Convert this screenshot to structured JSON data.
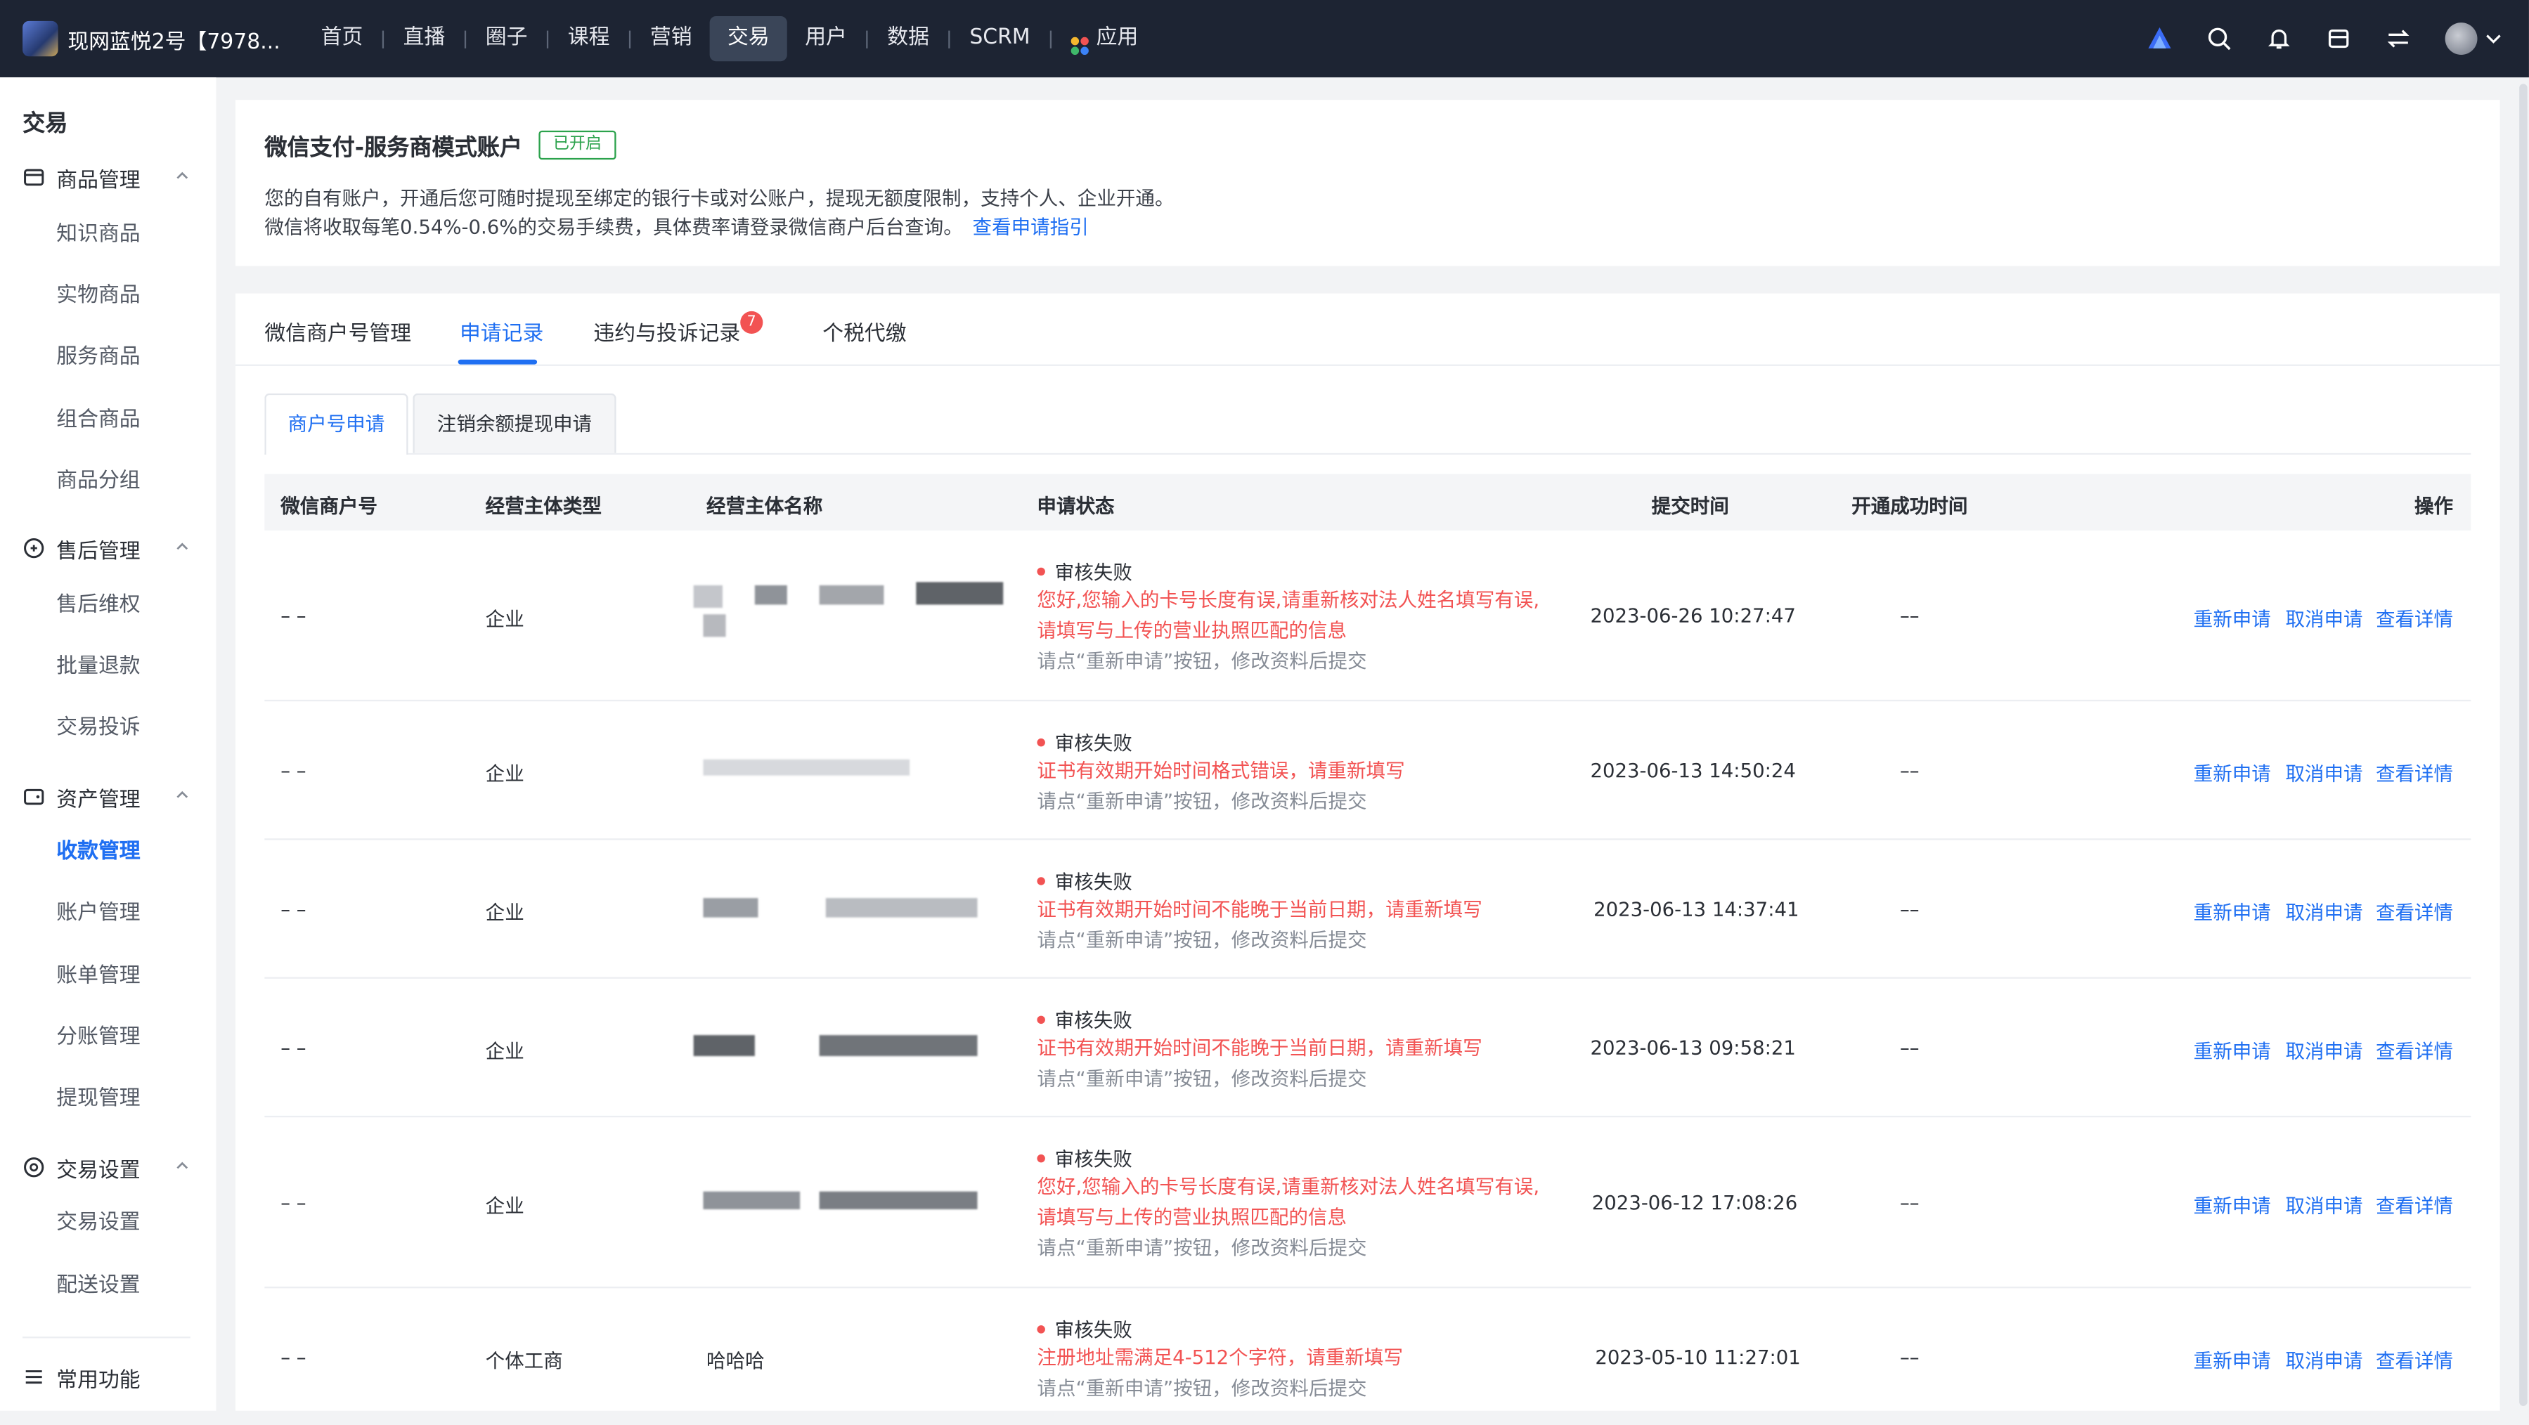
{
  "topbar": {
    "shop_name": "现网蓝悦2号【7978...",
    "nav": [
      "首页",
      "直播",
      "圈子",
      "课程",
      "营销",
      "交易",
      "用户",
      "数据",
      "SCRM",
      "应用"
    ],
    "active_nav": "交易",
    "icons": [
      "brand-logo-icon",
      "search-icon",
      "bell-icon",
      "store-icon",
      "switch-icon",
      "avatar",
      "chevron-down-icon"
    ]
  },
  "sidebar": {
    "title": "交易",
    "groups": [
      {
        "label": "商品管理",
        "icon": "box-icon",
        "items": [
          "知识商品",
          "实物商品",
          "服务商品",
          "组合商品",
          "商品分组"
        ]
      },
      {
        "label": "售后管理",
        "icon": "aftersale-icon",
        "items": [
          "售后维权",
          "批量退款",
          "交易投诉"
        ]
      },
      {
        "label": "资产管理",
        "icon": "wallet-icon",
        "items": [
          "收款管理",
          "账户管理",
          "账单管理",
          "分账管理",
          "提现管理"
        ]
      },
      {
        "label": "交易设置",
        "icon": "settings-icon",
        "items": [
          "交易设置",
          "配送设置"
        ]
      },
      {
        "label": "常用功能",
        "icon": "list-icon",
        "items": []
      }
    ],
    "active_item": "收款管理"
  },
  "account_card": {
    "title": "微信支付-服务商模式账户",
    "status_badge": "已开启",
    "desc_line1": "您的自有账户，开通后您可随时提现至绑定的银行卡或对公账户，提现无额度限制，支持个人、企业开通。",
    "desc_line2": "微信将收取每笔0.54%-0.6%的交易手续费，具体费率请登录微信商户后台查询。",
    "guide_link": "查看申请指引"
  },
  "tabs": {
    "items": [
      "微信商户号管理",
      "申请记录",
      "违约与投诉记录",
      "个税代缴"
    ],
    "active": "申请记录",
    "complaint_count": "7"
  },
  "subtabs": {
    "items": [
      "商户号申请",
      "注销余额提现申请"
    ],
    "active": "商户号申请"
  },
  "table": {
    "headers": [
      "微信商户号",
      "经营主体类型",
      "经营主体名称",
      "申请状态",
      "提交时间",
      "开通成功时间",
      "操作"
    ],
    "status_hint": "请点“重新申请”按钮，修改资料后提交",
    "actions": [
      "重新申请",
      "取消申请",
      "查看详情"
    ],
    "rows": [
      {
        "merchant_no": "– –",
        "type": "企业",
        "name": "",
        "status": "审核失败",
        "error": [
          "您好,您输入的卡号长度有误,请重新核对法人姓名填写有误,",
          "请填写与上传的营业执照匹配的信息"
        ],
        "submit_time": "2023-06-26 10:27:47",
        "open_time": "––"
      },
      {
        "merchant_no": "– –",
        "type": "企业",
        "name": "",
        "status": "审核失败",
        "error": [
          "证书有效期开始时间格式错误，请重新填写"
        ],
        "submit_time": "2023-06-13 14:50:24",
        "open_time": "––"
      },
      {
        "merchant_no": "– –",
        "type": "企业",
        "name": "",
        "status": "审核失败",
        "error": [
          "证书有效期开始时间不能晚于当前日期，请重新填写"
        ],
        "submit_time": "2023-06-13 14:37:41",
        "open_time": "––"
      },
      {
        "merchant_no": "– –",
        "type": "企业",
        "name": "",
        "status": "审核失败",
        "error": [
          "证书有效期开始时间不能晚于当前日期，请重新填写"
        ],
        "submit_time": "2023-06-13 09:58:21",
        "open_time": "––"
      },
      {
        "merchant_no": "– –",
        "type": "企业",
        "name": "",
        "status": "审核失败",
        "error": [
          "您好,您输入的卡号长度有误,请重新核对法人姓名填写有误,",
          "请填写与上传的营业执照匹配的信息"
        ],
        "submit_time": "2023-06-12 17:08:26",
        "open_time": "––"
      },
      {
        "merchant_no": "– –",
        "type": "个体工商",
        "name": "哈哈哈",
        "status": "审核失败",
        "error": [
          "注册地址需满足4-512个字符，请重新填写"
        ],
        "submit_time": "2023-05-10 11:27:01",
        "open_time": "––"
      }
    ]
  },
  "colors": {
    "topbar": "#1d2433",
    "accent": "#1f6ff2",
    "error": "#f25353",
    "success": "#2ba24c"
  }
}
